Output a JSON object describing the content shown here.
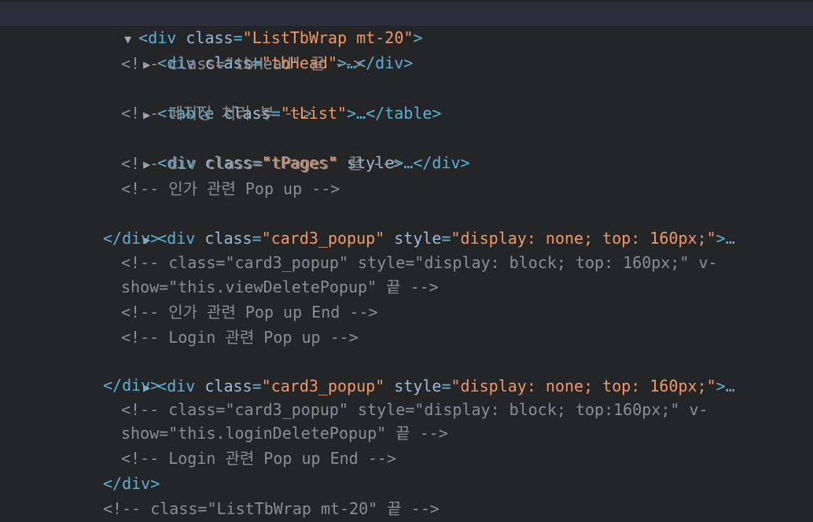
{
  "theme": {
    "background": "#242526",
    "selected_row": "#2b2f39",
    "tag_color": "#5db0d7",
    "attr_color": "#9bbbdc",
    "value_color": "#f29766",
    "comment_color": "#8e8e8e"
  },
  "icons": {
    "expanded": "▼",
    "collapsed": "▶"
  },
  "dom": {
    "root_open": {
      "tag": "<div",
      "attr": "class",
      "value": "\"ListTbWrap mt-20\"",
      "end": ">"
    },
    "tbhead": {
      "open": "<div",
      "attr": "class",
      "value": "\"tbHead\"",
      "rest": ">…</div>"
    },
    "comment_tbhead": "<!-- class=\"tbHead\" 끝 -->",
    "table": {
      "open": "<table",
      "attr": "class",
      "value": "\"tList\"",
      "rest": ">…</table>"
    },
    "comment_paging": "<!-- 페지징 처리 부 -->",
    "tpages": {
      "open": "<div",
      "attr": "class",
      "value": "\"tPages\"",
      "style_attr": "style",
      "rest": ">…</div>"
    },
    "comment_tpages": "<!-- div class=\"tPages\" 끝 -->",
    "comment_auth_popup": "<!-- 인가 관련 Pop up -->",
    "popup1": {
      "open": "<div",
      "attr": "class",
      "value": "\"card3_popup\"",
      "style_attr": "style",
      "style_value": "\"display: none; top: 160px;\"",
      "rest": ">…",
      "close": "</div>"
    },
    "comment_popup1_a": "<!-- class=\"card3_popup\" style=\"display: block; top: 160px;\" v-",
    "comment_popup1_b": "show=\"this.viewDeletePopup\" 끝 -->",
    "comment_auth_popup_end": "<!-- 인가 관련 Pop up End -->",
    "comment_login_popup": "<!-- Login 관련 Pop up -->",
    "popup2": {
      "open": "<div",
      "attr": "class",
      "value": "\"card3_popup\"",
      "style_attr": "style",
      "style_value": "\"display: none; top: 160px;\"",
      "rest": ">…",
      "close": "</div>"
    },
    "comment_popup2_a": "<!-- class=\"card3_popup\" style=\"display: block; top:160px;\" v-",
    "comment_popup2_b": "show=\"this.loginDeletePopup\" 끝 -->",
    "comment_login_popup_end": "<!-- Login 관련 Pop up End -->",
    "root_close": "</div>",
    "comment_root_end": "<!-- class=\"ListTbWrap mt-20\" 끝 -->"
  }
}
